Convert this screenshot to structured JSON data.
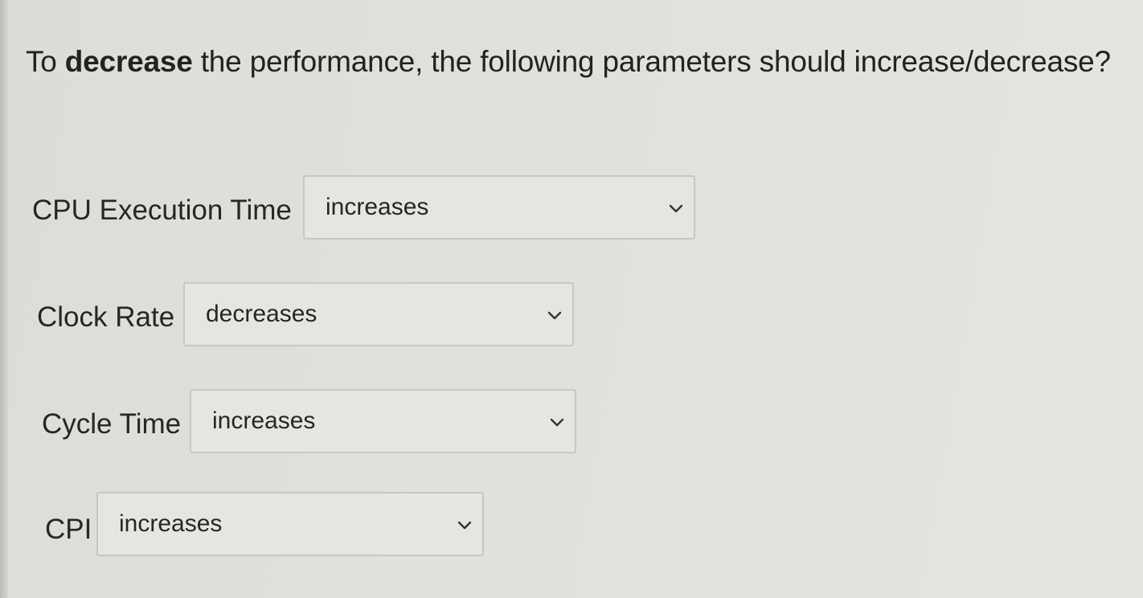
{
  "question": {
    "prefix": "To ",
    "emphasis": "decrease",
    "suffix": " the performance, the following parameters should increase/decrease?"
  },
  "rows": [
    {
      "label": "CPU Execution Time",
      "selected": "increases",
      "icon": "chevron-down-icon"
    },
    {
      "label": "Clock Rate",
      "selected": "decreases",
      "icon": "chevron-down-icon"
    },
    {
      "label": "Cycle Time",
      "selected": "increases",
      "icon": "chevron-down-icon"
    },
    {
      "label": "CPI",
      "selected": "increases",
      "icon": "chevron-down-icon"
    }
  ],
  "colors": {
    "background": "#e2e0dc",
    "select_border": "#c9c7c3",
    "text": "#222222"
  }
}
